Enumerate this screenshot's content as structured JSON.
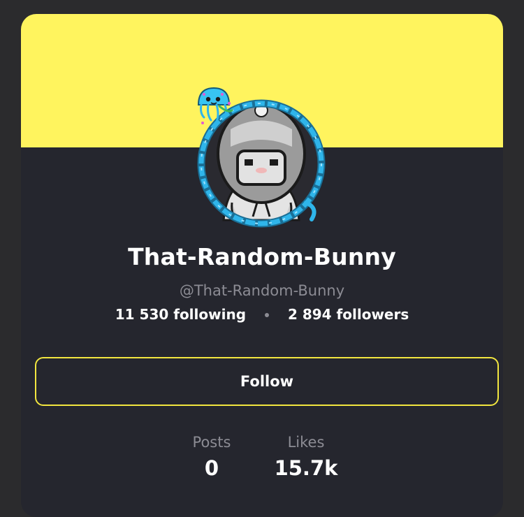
{
  "profile": {
    "display_name": "That-Random-Bunny",
    "handle": "@That-Random-Bunny",
    "following": "11 530 following",
    "followers": "2 894 followers",
    "avatar_icon": "hooded-bunny-avatar-icon",
    "frame_icon": "jellyfish-ring-frame-icon"
  },
  "actions": {
    "follow_label": "Follow"
  },
  "stats": {
    "posts_label": "Posts",
    "posts_value": "0",
    "likes_label": "Likes",
    "likes_value": "15.7k"
  },
  "colors": {
    "page_background": "#2b2b2d",
    "card_background": "#25262e",
    "banner": "#fff45e",
    "button_border": "#f2e63f",
    "frame_ring": "#2fb5ea",
    "muted_text": "#8c8c94"
  }
}
